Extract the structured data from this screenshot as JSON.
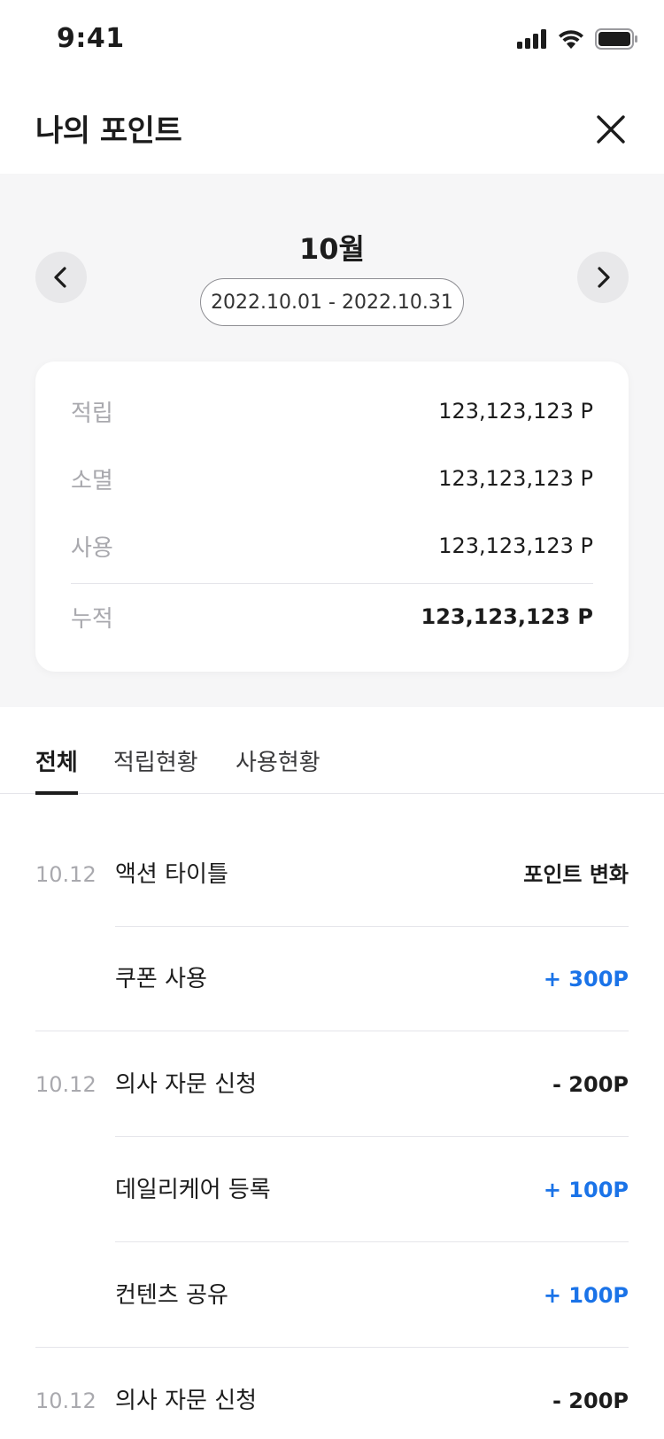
{
  "status_bar": {
    "time": "9:41"
  },
  "header": {
    "title": "나의 포인트"
  },
  "summary": {
    "month": "10월",
    "date_range": "2022.10.01 - 2022.10.31",
    "rows": [
      {
        "label": "적립",
        "value": "123,123,123 P"
      },
      {
        "label": "소멸",
        "value": "123,123,123 P"
      },
      {
        "label": "사용",
        "value": "123,123,123 P"
      },
      {
        "label": "누적",
        "value": "123,123,123 P"
      }
    ]
  },
  "tabs": [
    {
      "label": "전체",
      "active": true
    },
    {
      "label": "적립현황",
      "active": false
    },
    {
      "label": "사용현황",
      "active": false
    }
  ],
  "history": [
    {
      "date": "10.12",
      "title": "액션 타이틀",
      "value": "포인트 변화",
      "type": "header"
    },
    {
      "date": "",
      "title": "쿠폰 사용",
      "value": "+ 300P",
      "type": "plus"
    },
    {
      "date": "10.12",
      "title": "의사 자문 신청",
      "value": "- 200P",
      "type": "minus"
    },
    {
      "date": "",
      "title": "데일리케어 등록",
      "value": "+ 100P",
      "type": "plus"
    },
    {
      "date": "",
      "title": "컨텐츠 공유",
      "value": "+ 100P",
      "type": "plus"
    },
    {
      "date": "10.12",
      "title": "의사 자문 신청",
      "value": "- 200P",
      "type": "minus"
    }
  ],
  "colors": {
    "accent_plus": "#1a73e8",
    "text": "#1c1c1c",
    "muted": "#a9a9ae",
    "summary_bg": "#f6f6f7"
  },
  "icons": {
    "close": "close-icon",
    "prev": "chevron-left-icon",
    "next": "chevron-right-icon"
  }
}
